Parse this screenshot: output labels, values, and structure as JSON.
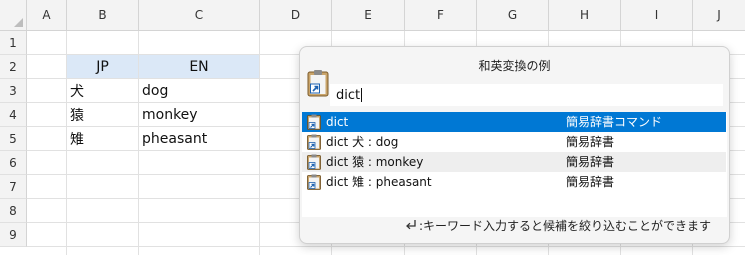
{
  "sheet": {
    "columns": [
      "A",
      "B",
      "C",
      "D",
      "E",
      "F",
      "G",
      "H",
      "I",
      "J"
    ],
    "rows": [
      "1",
      "2",
      "3",
      "4",
      "5",
      "6",
      "7",
      "8",
      "9"
    ],
    "cells": {
      "B2": "JP",
      "C2": "EN",
      "B3": "犬",
      "C3": "dog",
      "B4": "猿",
      "C4": "monkey",
      "B5": "雉",
      "C5": "pheasant"
    },
    "header_fill": "#dbe8f7"
  },
  "popup": {
    "title": "和英変換の例",
    "search_value": "dict",
    "selected_color": "#0078d4",
    "results": [
      {
        "label": "dict",
        "type": "簡易辞書コマンド",
        "icon": "clipboard-shortcut-icon"
      },
      {
        "label": "dict 犬 : dog",
        "type": "簡易辞書",
        "icon": "clipboard-shortcut-icon"
      },
      {
        "label": "dict 猿 : monkey",
        "type": "簡易辞書",
        "icon": "clipboard-shortcut-icon"
      },
      {
        "label": "dict 雉 : pheasant",
        "type": "簡易辞書",
        "icon": "clipboard-shortcut-icon"
      }
    ],
    "footer_hint": ":キーワード入力すると候補を絞り込むことができます",
    "footer_icon": "enter-key-icon"
  }
}
